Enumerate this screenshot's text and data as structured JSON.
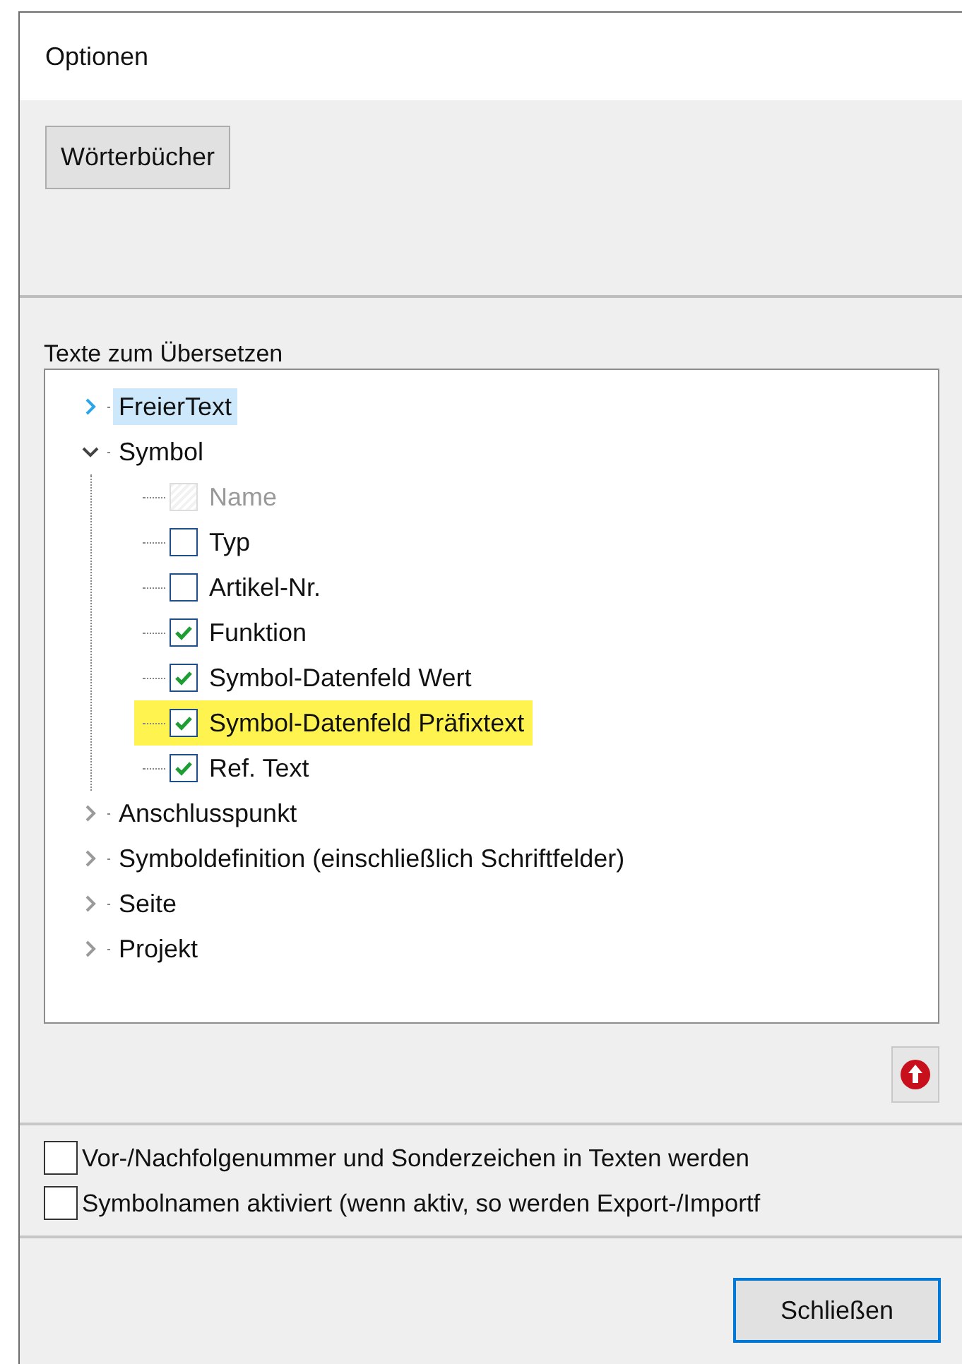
{
  "window": {
    "title": "Optionen"
  },
  "dictionaries_button": "Wörterbücher",
  "tree": {
    "label": "Texte zum Übersetzen",
    "items": [
      {
        "label": "FreierText",
        "expanded": false,
        "selected": true
      },
      {
        "label": "Symbol",
        "expanded": true,
        "selected": false,
        "children": [
          {
            "label": "Name",
            "checked": false,
            "disabled": true,
            "highlighted": false
          },
          {
            "label": "Typ",
            "checked": false,
            "disabled": false,
            "highlighted": false
          },
          {
            "label": "Artikel-Nr.",
            "checked": false,
            "disabled": false,
            "highlighted": false
          },
          {
            "label": "Funktion",
            "checked": true,
            "disabled": false,
            "highlighted": false
          },
          {
            "label": "Symbol-Datenfeld Wert",
            "checked": true,
            "disabled": false,
            "highlighted": false
          },
          {
            "label": "Symbol-Datenfeld Präfixtext",
            "checked": true,
            "disabled": false,
            "highlighted": true
          },
          {
            "label": "Ref. Text",
            "checked": true,
            "disabled": false,
            "highlighted": false
          }
        ]
      },
      {
        "label": "Anschlusspunkt",
        "expanded": false,
        "selected": false
      },
      {
        "label": "Symboldefinition (einschließlich Schriftfelder)",
        "expanded": false,
        "selected": false
      },
      {
        "label": "Seite",
        "expanded": false,
        "selected": false
      },
      {
        "label": "Projekt",
        "expanded": false,
        "selected": false
      }
    ]
  },
  "options": [
    {
      "label": "Vor-/Nachfolgenummer und Sonderzeichen in Texten werden",
      "checked": false
    },
    {
      "label": "Symbolnamen aktiviert (wenn aktiv, so werden Export-/Importf",
      "checked": false
    }
  ],
  "close_button": "Schließen"
}
